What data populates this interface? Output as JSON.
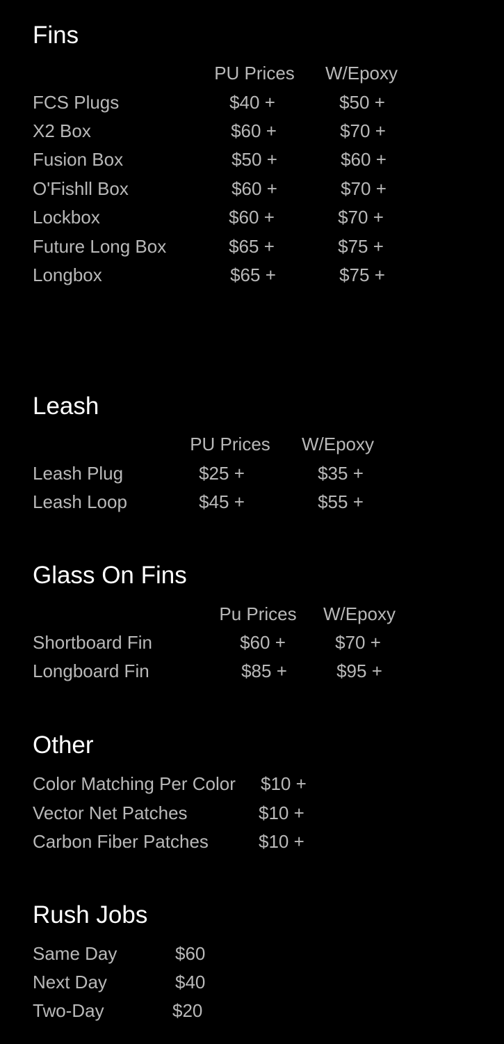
{
  "fins": {
    "title": "Fins",
    "col_pu": "PU Prices",
    "col_epoxy": "W/Epoxy",
    "rows": [
      {
        "name": "FCS Plugs",
        "pu": "$40 +",
        "epoxy": "$50 +"
      },
      {
        "name": "X2 Box",
        "pu": "$60 +",
        "epoxy": "$70 +"
      },
      {
        "name": "Fusion Box",
        "pu": "$50 +",
        "epoxy": "$60 +"
      },
      {
        "name": "O'Fishll Box",
        "pu": "$60 +",
        "epoxy": "$70 +"
      },
      {
        "name": "Lockbox",
        "pu": "$60 +",
        "epoxy": "$70 +"
      },
      {
        "name": "Future  Long Box",
        "pu": "$65 +",
        "epoxy": "$75 +"
      },
      {
        "name": "Longbox",
        "pu": "$65 +",
        "epoxy": "$75 +"
      }
    ]
  },
  "leash": {
    "title": "Leash",
    "col_pu": "PU Prices",
    "col_epoxy": "W/Epoxy",
    "rows": [
      {
        "name": "Leash Plug",
        "pu": "$25 +",
        "epoxy": "$35 +"
      },
      {
        "name": "Leash Loop",
        "pu": "$45 +",
        "epoxy": "$55 +"
      }
    ]
  },
  "glass_on_fins": {
    "title": "Glass On Fins",
    "col_pu": "Pu Prices",
    "col_epoxy": "W/Epoxy",
    "rows": [
      {
        "name": "Shortboard Fin",
        "pu": "$60 +",
        "epoxy": "$70 +"
      },
      {
        "name": "Longboard  Fin",
        "pu": "$85 +",
        "epoxy": "$95 +"
      }
    ]
  },
  "other": {
    "title": "Other",
    "rows": [
      {
        "name": "Color Matching Per Color",
        "price": "$10 +"
      },
      {
        "name": "Vector Net Patches",
        "price": "$10 +"
      },
      {
        "name": "Carbon Fiber Patches",
        "price": "$10 +"
      }
    ]
  },
  "rush_jobs": {
    "title": "Rush Jobs",
    "rows": [
      {
        "name": "Same Day",
        "price": "$60"
      },
      {
        "name": "Next Day",
        "price": "$40"
      },
      {
        "name": "Two-Day",
        "price": "$20"
      }
    ]
  }
}
